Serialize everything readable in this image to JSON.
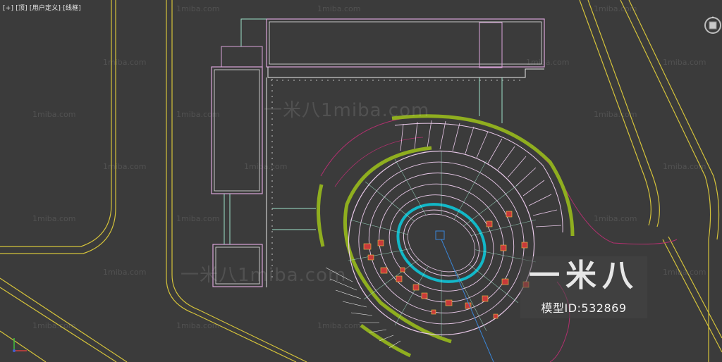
{
  "viewport": {
    "label": "[+] [顶] [用户定义] [线框]"
  },
  "watermarks": {
    "small": "1miba.com",
    "big": "一米八1miba.com"
  },
  "logo": {
    "title": "一米八",
    "model_id": "模型ID:532869"
  },
  "colors": {
    "background": "#3b3b3b",
    "road_lines": "#d4c23a",
    "building_outline": "#d9a3d8",
    "building_inner": "#e8e8e8",
    "connector": "#9ee0c8",
    "green_rail": "#8fae1f",
    "stand_lines": "#e9c9e9",
    "inner_ring": "#12b8c8",
    "curve_purple": "#b0306e",
    "axis_line": "#3a86d8"
  },
  "icons": {
    "viewcube": "viewcube-compass-icon",
    "axis": "axis-tripod-icon"
  }
}
